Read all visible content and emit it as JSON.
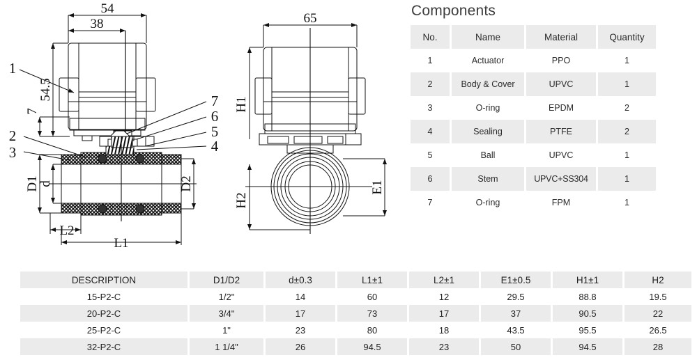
{
  "components_panel": {
    "title": "Components",
    "columns": [
      "No.",
      "Name",
      "Material",
      "Quantity"
    ],
    "rows": [
      {
        "no": "1",
        "name": "Actuator",
        "material": "PPO",
        "quantity": "1"
      },
      {
        "no": "2",
        "name": "Body & Cover",
        "material": "UPVC",
        "quantity": "1"
      },
      {
        "no": "3",
        "name": "O-ring",
        "material": "EPDM",
        "quantity": "2"
      },
      {
        "no": "4",
        "name": "Sealing",
        "material": "PTFE",
        "quantity": "2"
      },
      {
        "no": "5",
        "name": "Ball",
        "material": "UPVC",
        "quantity": "1"
      },
      {
        "no": "6",
        "name": "Stem",
        "material": "UPVC+SS304",
        "quantity": "1"
      },
      {
        "no": "7",
        "name": "O-ring",
        "material": "FPM",
        "quantity": "1"
      }
    ]
  },
  "spec_table": {
    "columns": [
      "DESCRIPTION",
      "D1/D2",
      "d±0.3",
      "L1±1",
      "L2±1",
      "E1±0.5",
      "H1±1",
      "H2"
    ],
    "rows": [
      {
        "description": "15-P2-C",
        "d1d2": "1/2\"",
        "d": "14",
        "l1": "60",
        "l2": "12",
        "e1": "29.5",
        "h1": "88.8",
        "h2": "19.5"
      },
      {
        "description": "20-P2-C",
        "d1d2": "3/4\"",
        "d": "17",
        "l1": "73",
        "l2": "17",
        "e1": "37",
        "h1": "90.5",
        "h2": "22"
      },
      {
        "description": "25-P2-C",
        "d1d2": "1\"",
        "d": "23",
        "l1": "80",
        "l2": "18",
        "e1": "43.5",
        "h1": "95.5",
        "h2": "26.5"
      },
      {
        "description": "32-P2-C",
        "d1d2": "1 1/4\"",
        "d": "26",
        "l1": "94.5",
        "l2": "23",
        "e1": "50",
        "h1": "94.5",
        "h2": "28"
      }
    ]
  },
  "front_view": {
    "dim_54": "54",
    "dim_38": "38",
    "dim_54_5": "54.5",
    "dim_7": "7",
    "dim_D1": "D1",
    "dim_d": "d",
    "dim_D2": "D2",
    "dim_L1": "L1",
    "dim_L2": "L2",
    "callouts": [
      "1",
      "2",
      "3",
      "4",
      "5",
      "6",
      "7"
    ]
  },
  "side_view": {
    "dim_65": "65",
    "dim_H1": "H1",
    "dim_H2": "H2",
    "dim_E1": "E1"
  },
  "colors": {
    "table_shade": "#ebebeb",
    "line": "#111111",
    "background": "#ffffff"
  }
}
